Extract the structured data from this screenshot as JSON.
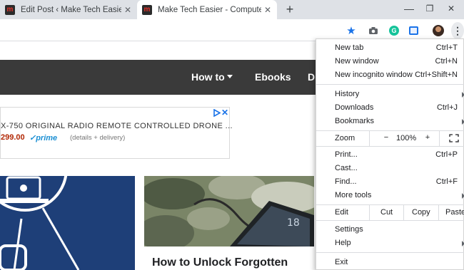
{
  "browser": {
    "tabs": [
      {
        "title": "Edit Post ‹ Make Tech Easier — W",
        "favicon": "m",
        "active": false
      },
      {
        "title": "Make Tech Easier - Computer Tut",
        "favicon": "m",
        "active": true
      }
    ],
    "new_tab_symbol": "+",
    "window_controls": {
      "minimize": "—",
      "maximize": "❐",
      "close": "✕"
    }
  },
  "site": {
    "nav": {
      "howto": "How to",
      "ebooks": "Ebooks",
      "partial": "D"
    },
    "ad": {
      "title": "X-750 ORIGINAL RADIO REMOTE CONTROLLED DRONE ...",
      "price": "299.00",
      "prime": "✓prime",
      "details": "(details + delivery)"
    },
    "card_title": "How to Unlock Forgotten"
  },
  "menu": {
    "items_top": [
      {
        "label": "New tab",
        "shortcut": "Ctrl+T"
      },
      {
        "label": "New window",
        "shortcut": "Ctrl+N"
      },
      {
        "label": "New incognito window",
        "shortcut": "Ctrl+Shift+N"
      }
    ],
    "items_history": [
      {
        "label": "History",
        "shortcut": "",
        "submenu": true
      },
      {
        "label": "Downloads",
        "shortcut": "Ctrl+J",
        "submenu": false
      },
      {
        "label": "Bookmarks",
        "shortcut": "",
        "submenu": true
      }
    ],
    "zoom": {
      "label": "Zoom",
      "minus": "−",
      "value": "100%",
      "plus": "+"
    },
    "items_tools": [
      {
        "label": "Print...",
        "shortcut": "Ctrl+P",
        "submenu": false
      },
      {
        "label": "Cast...",
        "shortcut": "",
        "submenu": false
      },
      {
        "label": "Find...",
        "shortcut": "Ctrl+F",
        "submenu": false
      },
      {
        "label": "More tools",
        "shortcut": "",
        "submenu": true
      }
    ],
    "edit": {
      "label": "Edit",
      "cut": "Cut",
      "copy": "Copy",
      "paste": "Paste"
    },
    "items_settings": [
      {
        "label": "Settings",
        "shortcut": "",
        "submenu": false
      },
      {
        "label": "Help",
        "shortcut": "",
        "submenu": true
      }
    ],
    "exit": "Exit"
  },
  "colors": {
    "nav_bg": "#3a3a3a",
    "accent": "#1a73e8",
    "price": "#b12704",
    "card_blue": "#1e3f78"
  },
  "icons": [
    "star-icon",
    "camera-icon",
    "grammarly-icon",
    "cast-extension-icon",
    "profile-avatar",
    "kebab-menu-icon",
    "fullscreen-icon"
  ]
}
